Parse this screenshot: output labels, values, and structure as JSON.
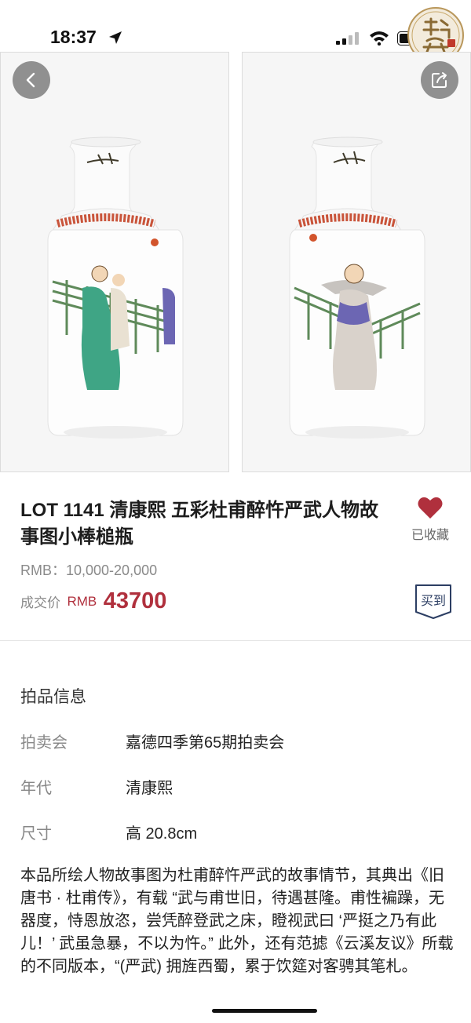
{
  "status_bar": {
    "time": "18:37"
  },
  "lot": {
    "title": "LOT 1141 清康熙  五彩杜甫醉忤严武人物故事图小棒槌瓶",
    "favorite_label": "已收藏",
    "estimate": "RMB：10,000-20,000",
    "deal_label": "成交价",
    "deal_currency": "RMB",
    "deal_price": "43700",
    "buy_badge": "买到"
  },
  "info": {
    "section_title": "拍品信息",
    "rows": [
      {
        "key": "拍卖会",
        "value": "嘉德四季第65期拍卖会"
      },
      {
        "key": "年代",
        "value": "清康熙"
      },
      {
        "key": "尺寸",
        "value": "高 20.8cm"
      }
    ],
    "description": "本品所绘人物故事图为杜甫醉忤严武的故事情节，其典出《旧唐书 · 杜甫传》，有载 “武与甫世旧，待遇甚隆。甫性褊躁，无器度，恃恩放恣，尝凭醉登武之床，瞪视武曰 ‘严挺之乃有此儿！’ 武虽急暴，不以为忤。” 此外，还有范摅《云溪友议》所载的不同版本，“(严武) 拥旌西蜀，累于饮筵对客骋其笔札。"
  },
  "icons": {
    "back": "chevron-left-icon",
    "share": "share-icon",
    "favorite": "heart-icon",
    "seal": "seal-logo-icon"
  },
  "colors": {
    "accent_red": "#b0303d",
    "badge_navy": "#2c3e63"
  }
}
